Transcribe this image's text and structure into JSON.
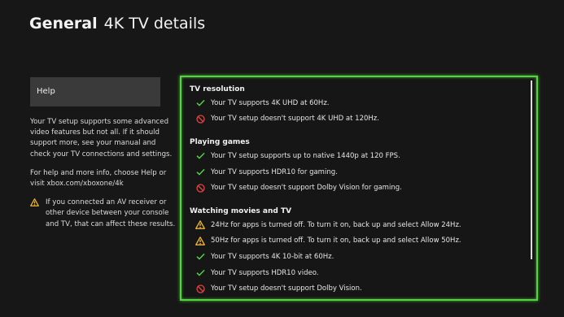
{
  "header": {
    "section": "General",
    "page": "4K TV details"
  },
  "sidebar": {
    "help_label": "Help",
    "description": "Your TV setup supports some advanced video features but not all. If it should support more, see your manual and check your TV connections and settings.",
    "help_info": "For help and more info, choose Help or visit xbox.com/xboxone/4k",
    "warning": "If you connected an AV receiver or other device between your console and TV, that can affect these results."
  },
  "colors": {
    "accent_green": "#56d245",
    "error_red": "#e04646",
    "warning_yellow": "#f2b933"
  },
  "sections": [
    {
      "title": "TV resolution",
      "items": [
        {
          "status": "ok",
          "icon": "check-icon",
          "text": "Your TV supports 4K UHD at 60Hz."
        },
        {
          "status": "error",
          "icon": "blocked-icon",
          "text": "Your TV setup doesn't support 4K UHD at 120Hz."
        }
      ]
    },
    {
      "title": "Playing games",
      "items": [
        {
          "status": "ok",
          "icon": "check-icon",
          "text": "Your TV setup supports up to native 1440p at 120 FPS."
        },
        {
          "status": "ok",
          "icon": "check-icon",
          "text": "Your TV supports HDR10 for gaming."
        },
        {
          "status": "error",
          "icon": "blocked-icon",
          "text": "Your TV setup doesn't support Dolby Vision for gaming."
        }
      ]
    },
    {
      "title": "Watching movies and TV",
      "items": [
        {
          "status": "warning",
          "icon": "warning-icon",
          "text": "24Hz for apps is turned off. To turn it on, back up and select Allow 24Hz."
        },
        {
          "status": "warning",
          "icon": "warning-icon",
          "text": "50Hz for apps is turned off. To turn it on, back up and select Allow 50Hz."
        },
        {
          "status": "ok",
          "icon": "check-icon",
          "text": "Your TV supports 4K 10-bit at 60Hz."
        },
        {
          "status": "ok",
          "icon": "check-icon",
          "text": "Your TV supports HDR10 video."
        },
        {
          "status": "error",
          "icon": "blocked-icon",
          "text": "Your TV setup doesn't support Dolby Vision."
        }
      ]
    }
  ]
}
